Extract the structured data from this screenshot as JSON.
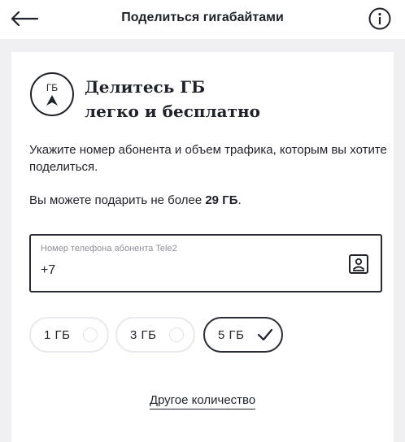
{
  "header": {
    "title": "Поделиться гигабайтами"
  },
  "promo": {
    "badge_text": "ГБ",
    "title_line1": "Делитесь ГБ",
    "title_line2": "легко и бесплатно"
  },
  "instruction": "Укажите номер абонента и объем трафика, которым вы хотите поделиться.",
  "limit": {
    "prefix": "Вы можете подарить не более ",
    "amount": "29 ГБ",
    "suffix": "."
  },
  "phone_field": {
    "label": "Номер телефона абонента Tele2",
    "value": "+7"
  },
  "options": [
    {
      "label": "1 ГБ",
      "selected": false
    },
    {
      "label": "3 ГБ",
      "selected": false
    },
    {
      "label": "5 ГБ",
      "selected": true
    }
  ],
  "other_amount_link": "Другое количество",
  "icons": {
    "back": "arrow-left-icon",
    "info": "info-icon",
    "contacts": "contact-book-icon",
    "check": "checkmark-icon"
  },
  "colors": {
    "text": "#1f2229",
    "background": "#f0f0f2",
    "chip_border": "#e8e9ec",
    "selected_border": "#2a2c33"
  }
}
